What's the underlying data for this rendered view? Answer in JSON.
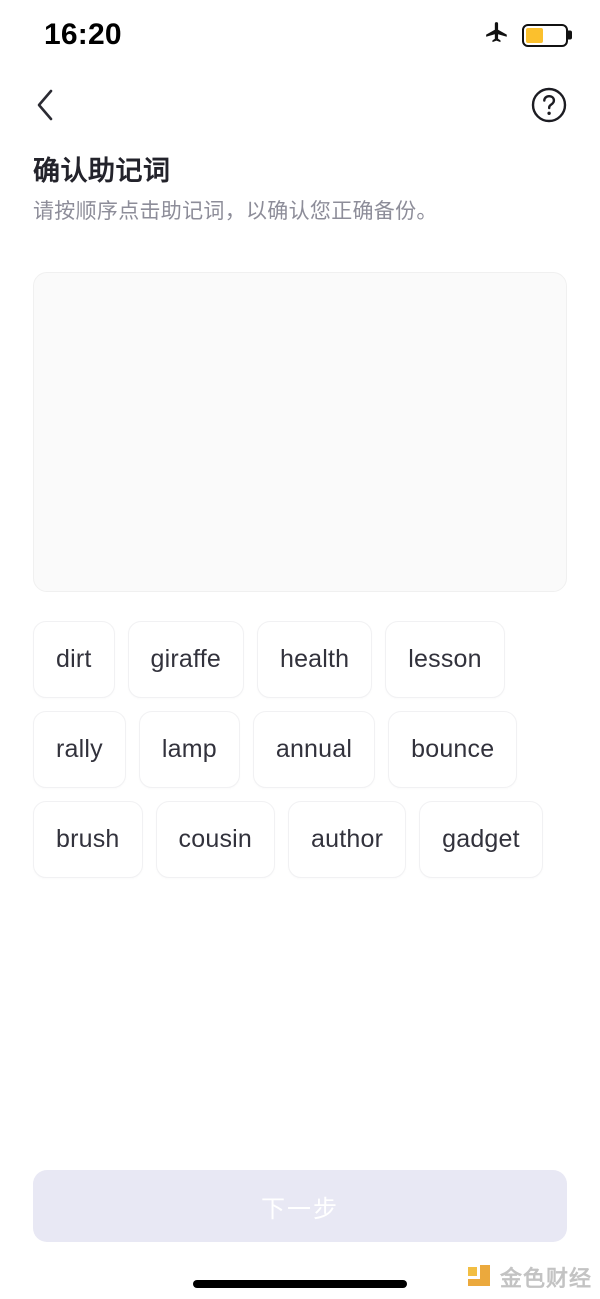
{
  "status_bar": {
    "time": "16:20",
    "airplane_icon": "airplane-mode-icon",
    "battery_icon": "battery-low-power-icon",
    "battery_level_percent": 45,
    "battery_color": "#FBC02D"
  },
  "nav": {
    "back_icon": "chevron-left-icon",
    "help_icon": "question-mark-circle-icon"
  },
  "header": {
    "title": "确认助记词",
    "subtitle": "请按顺序点击助记词，以确认您正确备份。"
  },
  "answer_area": {
    "selected_words": [],
    "placeholder": ""
  },
  "word_bank": {
    "words": [
      "dirt",
      "giraffe",
      "health",
      "lesson",
      "rally",
      "lamp",
      "annual",
      "bounce",
      "brush",
      "cousin",
      "author",
      "gadget"
    ]
  },
  "footer": {
    "next_label": "下一步",
    "next_disabled": true,
    "next_bg_color": "#e8e8f4",
    "next_text_color": "#ffffff"
  },
  "watermark": {
    "text": "金色财经",
    "logo_icon": "jinse-finance-logo-icon"
  },
  "home_indicator": {
    "icon": "home-indicator-bar"
  }
}
